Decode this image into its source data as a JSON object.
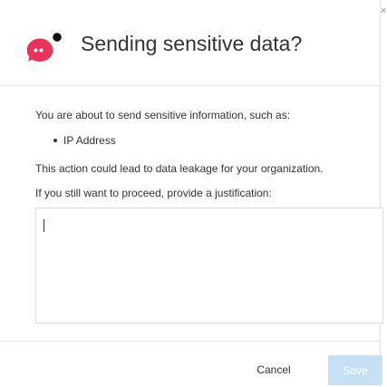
{
  "dialog": {
    "title": "Sending sensitive data?",
    "close_label": "×"
  },
  "brand": {
    "logo_icon": "pink-chat-bubble-with-dark-dot-logo",
    "accent_color": "#e8335a",
    "dot_color": "#111111"
  },
  "body": {
    "intro": "You are about to send sensitive information, such as:",
    "sensitive_items": [
      "IP Address"
    ],
    "warning": "This action could lead to data leakage for your organization.",
    "prompt": "If you still want to proceed, provide a justification:"
  },
  "justification_input": {
    "value": "",
    "placeholder": ""
  },
  "footer": {
    "cancel_label": "Cancel",
    "save_label": "Save",
    "save_color": "#c7e0f4"
  }
}
